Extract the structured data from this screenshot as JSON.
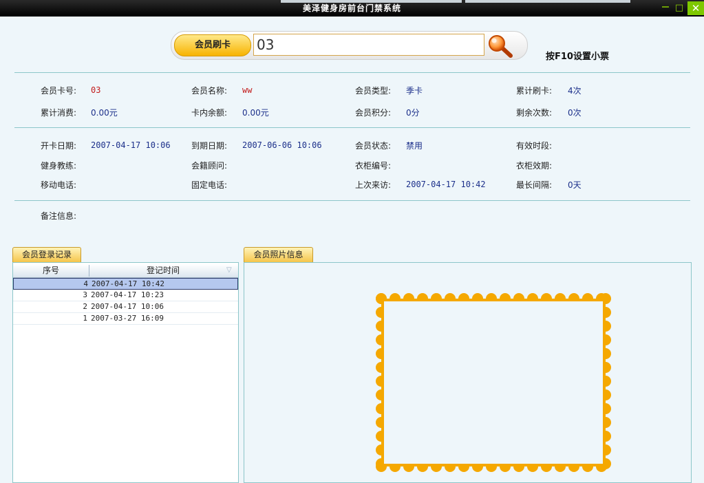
{
  "window": {
    "title": "美泽健身房前台门禁系统",
    "minimize": "－",
    "maximize": "□",
    "close": "✕"
  },
  "swipe": {
    "button_label": "会员刷卡",
    "card_input_value": "03",
    "search_icon": "magnifier-icon"
  },
  "hint": "按F10设置小票",
  "colors": {
    "accent": "#f7b300",
    "value_blue": "#1b2f8a",
    "value_red": "#c21b1b",
    "frame_orange": "#f5a800"
  },
  "info": {
    "card_no": {
      "label": "会员卡号:",
      "value": "03"
    },
    "name": {
      "label": "会员名称:",
      "value": "ww"
    },
    "type": {
      "label": "会员类型:",
      "value": "季卡"
    },
    "total_swipes": {
      "label": "累计刷卡:",
      "value": "4次"
    },
    "total_spend": {
      "label": "累计消费:",
      "value": "0.00元"
    },
    "balance": {
      "label": "卡内余额:",
      "value": "0.00元"
    },
    "points": {
      "label": "会员积分:",
      "value": "0分"
    },
    "remaining": {
      "label": "剩余次数:",
      "value": "0次"
    },
    "open_date": {
      "label": "开卡日期:",
      "value": "2007-04-17 10:06"
    },
    "expire_date": {
      "label": "到期日期:",
      "value": "2007-06-06 10:06"
    },
    "status": {
      "label": "会员状态:",
      "value": "禁用"
    },
    "valid_period": {
      "label": "有效时段:",
      "value": ""
    },
    "coach": {
      "label": "健身教练:",
      "value": ""
    },
    "consultant": {
      "label": "会籍顾问:",
      "value": ""
    },
    "locker_no": {
      "label": "衣柜编号:",
      "value": ""
    },
    "locker_expire": {
      "label": "衣柜效期:",
      "value": ""
    },
    "mobile": {
      "label": "移动电话:",
      "value": ""
    },
    "phone": {
      "label": "固定电话:",
      "value": ""
    },
    "last_visit": {
      "label": "上次来访:",
      "value": "2007-04-17 10:42"
    },
    "max_interval": {
      "label": "最长间隔:",
      "value": "0天"
    },
    "remark": {
      "label": "备注信息:",
      "value": ""
    }
  },
  "login_log": {
    "tab": "会员登录记录",
    "columns": [
      "序号",
      "登记时间"
    ],
    "rows": [
      {
        "no": "4",
        "time": "2007-04-17 10:42"
      },
      {
        "no": "3",
        "time": "2007-04-17 10:23"
      },
      {
        "no": "2",
        "time": "2007-04-17 10:06"
      },
      {
        "no": "1",
        "time": "2007-03-27 16:09"
      }
    ]
  },
  "photo": {
    "tab": "会员照片信息"
  }
}
